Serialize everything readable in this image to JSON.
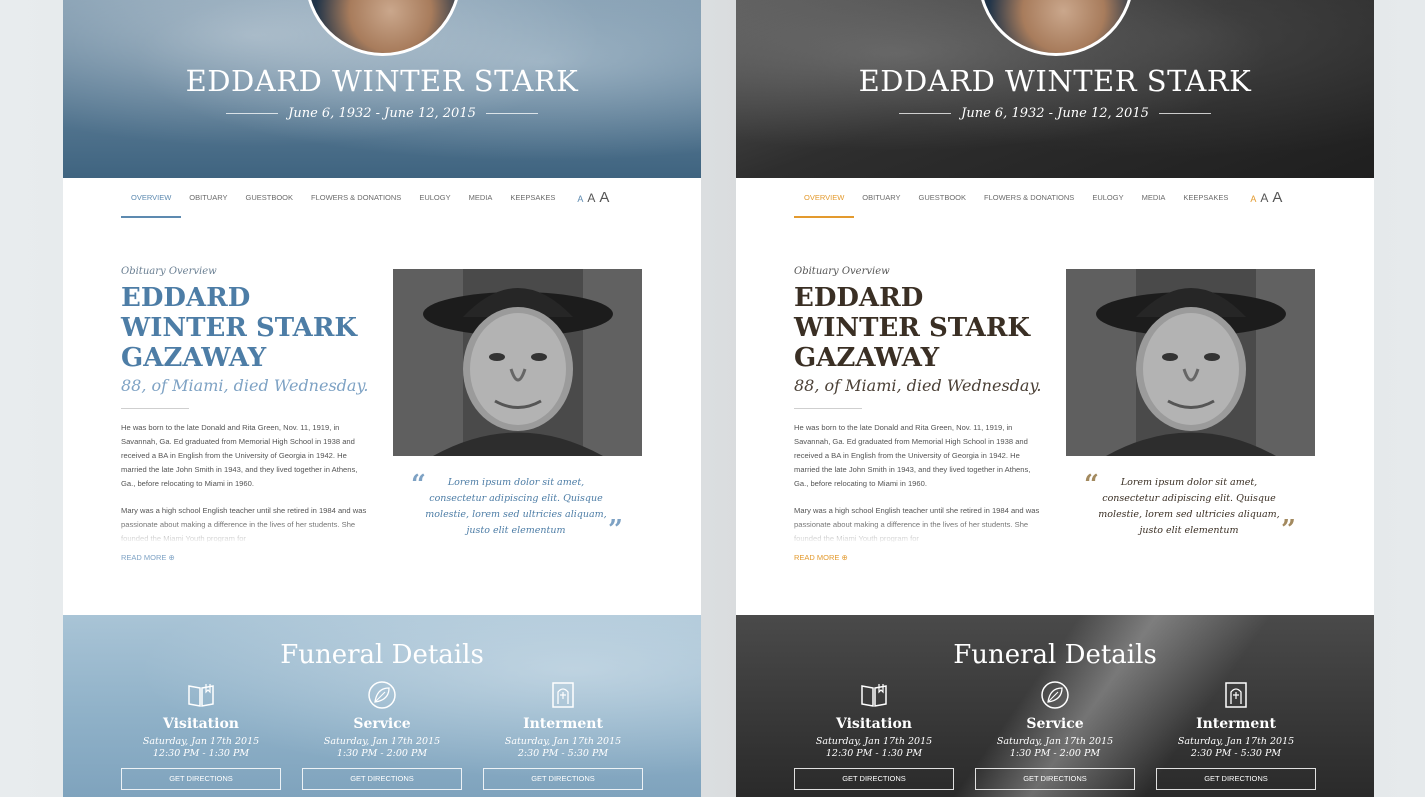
{
  "variants": [
    {
      "theme": "blue",
      "accent": "#5d8ab0",
      "hero": {
        "name": "EDDARD WINTER STARK",
        "dates": "June 6, 1932 - June 12, 2015"
      },
      "nav": {
        "items": [
          "OVERVIEW",
          "OBITUARY",
          "GUESTBOOK",
          "FLOWERS & DONATIONS",
          "EULOGY",
          "MEDIA",
          "KEEPSAKES"
        ],
        "active": "OVERVIEW",
        "font_sizes": [
          "A",
          "A",
          "A"
        ]
      },
      "overview": {
        "label": "Obituary Overview",
        "title": "EDDARD WINTER STARK GAZAWAY",
        "subtitle": "88, of Miami, died Wednesday.",
        "paragraphs": [
          "He was born to the late Donald and Rita Green, Nov. 11, 1919, in Savannah, Ga. Ed graduated from Memorial High School in 1938 and received a BA in English from the University of Georgia in 1942. He married the late John Smith in 1943, and they lived together in Athens, Ga., before relocating to Miami in 1960.",
          "Mary was a high school English teacher until she retired in 1984 and was passionate about making a difference in the lives of her students. She founded the Miami Youth program for"
        ],
        "read_more": "READ MORE",
        "quote": "Lorem ipsum dolor sit amet, consectetur adipiscing elit. Quisque molestie, lorem sed ultricies aliquam, justo elit elementum"
      },
      "funeral": {
        "title": "Funeral Details",
        "events": [
          {
            "icon": "book-icon",
            "name": "Visitation",
            "date": "Saturday, Jan 17th 2015",
            "time": "12:30 PM - 1:30 PM",
            "button": "GET DIRECTIONS"
          },
          {
            "icon": "leaf-icon",
            "name": "Service",
            "date": "Saturday, Jan 17th 2015",
            "time": "1:30 PM - 2:00 PM",
            "button": "GET DIRECTIONS"
          },
          {
            "icon": "headstone-icon",
            "name": "Interment",
            "date": "Saturday, Jan 17th 2015",
            "time": "2:30 PM - 5:30 PM",
            "button": "GET DIRECTIONS"
          }
        ]
      }
    },
    {
      "theme": "dark",
      "accent": "#e39a2e",
      "hero": {
        "name": "EDDARD WINTER STARK",
        "dates": "June 6, 1932 - June 12, 2015"
      },
      "nav": {
        "items": [
          "OVERVIEW",
          "OBITUARY",
          "GUESTBOOK",
          "FLOWERS & DONATIONS",
          "EULOGY",
          "MEDIA",
          "KEEPSAKES"
        ],
        "active": "OVERVIEW",
        "font_sizes": [
          "A",
          "A",
          "A"
        ]
      },
      "overview": {
        "label": "Obituary Overview",
        "title": "EDDARD WINTER STARK GAZAWAY",
        "subtitle": "88, of Miami, died Wednesday.",
        "paragraphs": [
          "He was born to the late Donald and Rita Green, Nov. 11, 1919, in Savannah, Ga. Ed graduated from Memorial High School in 1938 and received a BA in English from the University of Georgia in 1942. He married the late John Smith in 1943, and they lived together in Athens, Ga., before relocating to Miami in 1960.",
          "Mary was a high school English teacher until she retired in 1984 and was passionate about making a difference in the lives of her students. She founded the Miami Youth program for"
        ],
        "read_more": "READ MORE",
        "quote": "Lorem ipsum dolor sit amet, consectetur adipiscing elit. Quisque molestie, lorem sed ultricies aliquam, justo elit elementum"
      },
      "funeral": {
        "title": "Funeral Details",
        "events": [
          {
            "icon": "book-icon",
            "name": "Visitation",
            "date": "Saturday, Jan 17th 2015",
            "time": "12:30 PM - 1:30 PM",
            "button": "GET DIRECTIONS"
          },
          {
            "icon": "leaf-icon",
            "name": "Service",
            "date": "Saturday, Jan 17th 2015",
            "time": "1:30 PM - 2:00 PM",
            "button": "GET DIRECTIONS"
          },
          {
            "icon": "headstone-icon",
            "name": "Interment",
            "date": "Saturday, Jan 17th 2015",
            "time": "2:30 PM - 5:30 PM",
            "button": "GET DIRECTIONS"
          }
        ]
      }
    }
  ]
}
